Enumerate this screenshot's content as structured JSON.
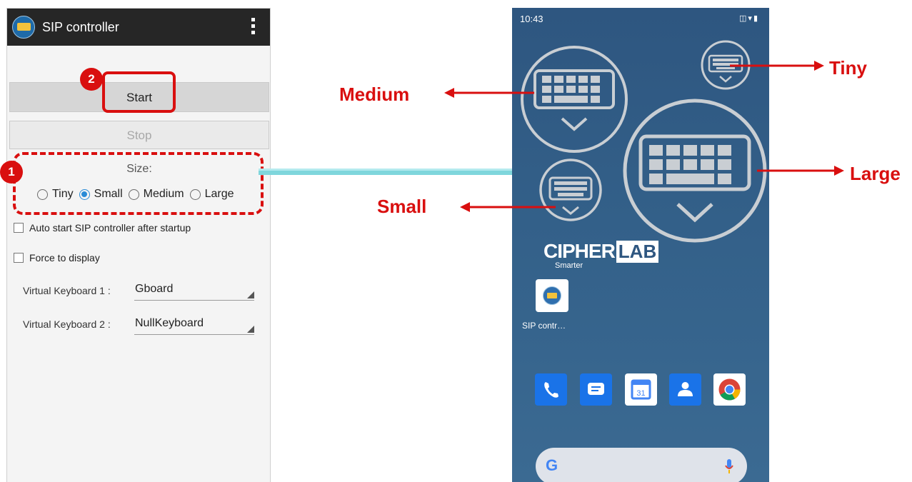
{
  "sip_app": {
    "title": "SIP controller",
    "start_label": "Start",
    "stop_label": "Stop",
    "size_label": "Size:",
    "size_options": [
      "Tiny",
      "Small",
      "Medium",
      "Large"
    ],
    "selected_size": "Small",
    "auto_start_label": "Auto start SIP controller after startup",
    "auto_start_checked": false,
    "force_display_label": "Force to display",
    "force_display_checked": false,
    "vk1_label": "Virtual Keyboard 1 :",
    "vk1_value": "Gboard",
    "vk2_label": "Virtual Keyboard 2 :",
    "vk2_value": "NullKeyboard"
  },
  "annotations": {
    "step1": "1",
    "step2": "2",
    "medium": "Medium",
    "small": "Small",
    "tiny": "Tiny",
    "large": "Large",
    "accent_color": "#d90f0f"
  },
  "home_screen": {
    "time": "10:43",
    "status_icons": [
      "vibrate-icon",
      "wifi-icon",
      "battery-icon"
    ],
    "brand_main": "CIPHER",
    "brand_lab": "LAB",
    "brand_sub": "Smarter",
    "shortcut_label": "SIP contr…",
    "calendar_day": "31",
    "dock": [
      "phone-icon",
      "messages-icon",
      "calendar-icon",
      "contacts-icon",
      "chrome-icon"
    ],
    "search_logo": "G"
  }
}
